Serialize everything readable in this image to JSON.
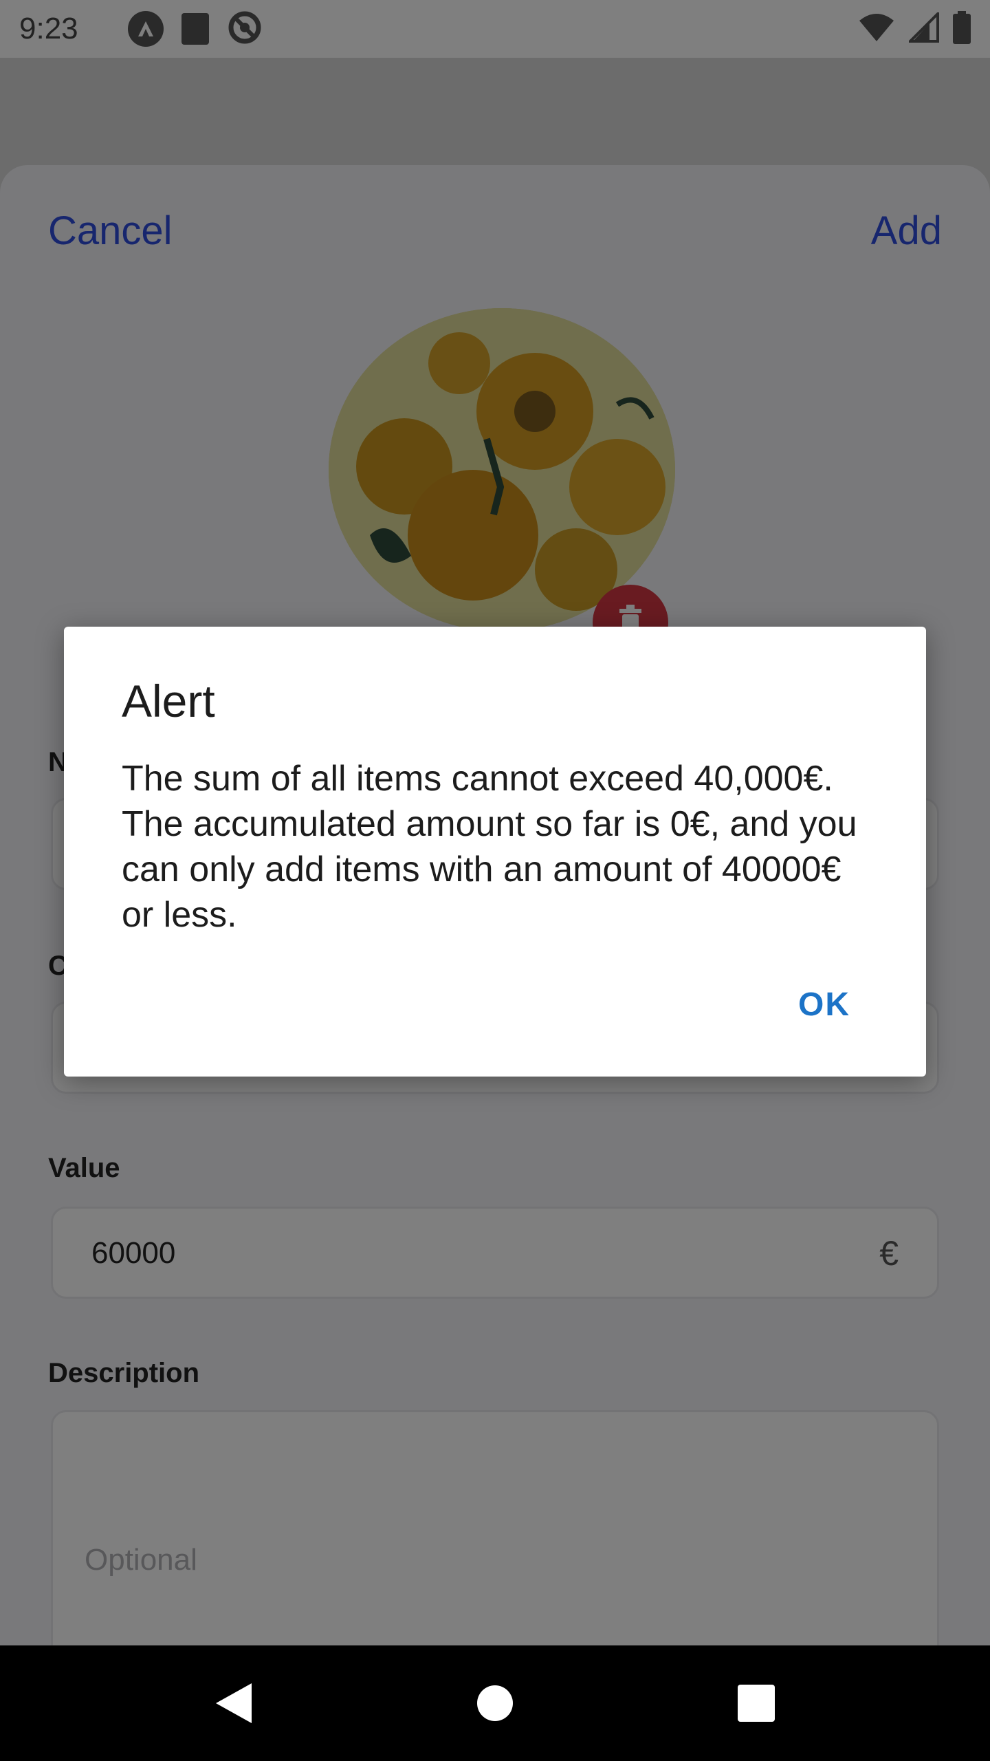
{
  "status_bar": {
    "time": "9:23"
  },
  "sheet": {
    "cancel_label": "Cancel",
    "add_label": "Add"
  },
  "form": {
    "name_label": "N",
    "category_label": "C",
    "value_label": "Value",
    "value_amount": "60000",
    "currency_symbol": "€",
    "description_label": "Description",
    "description_placeholder": "Optional"
  },
  "dialog": {
    "title": "Alert",
    "message": "The sum of all items cannot exceed 40,000€. The accumulated amount so far is 0€, and you can only add items with an amount of 40000€ or less.",
    "ok_label": "OK"
  },
  "colors": {
    "accent": "#2f4cdd",
    "dialog_button": "#1c73c7",
    "delete": "#d23742"
  }
}
